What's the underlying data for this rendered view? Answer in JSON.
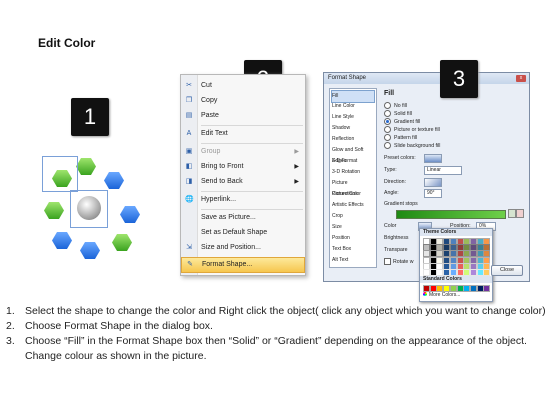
{
  "title": "Edit Color",
  "steps": [
    "1",
    "2",
    "3"
  ],
  "context_menu": {
    "items": [
      {
        "label": "Cut",
        "icon": "scissors-icon"
      },
      {
        "label": "Copy",
        "icon": "copy-icon"
      },
      {
        "label": "Paste",
        "icon": "paste-icon"
      },
      {
        "label": "Edit Text",
        "icon": "edit-text-icon"
      },
      {
        "label": "Group",
        "icon": "group-icon"
      },
      {
        "label": "Bring to Front",
        "icon": "bring-front-icon"
      },
      {
        "label": "Send to Back",
        "icon": "send-back-icon"
      },
      {
        "label": "Hyperlink...",
        "icon": "hyperlink-icon"
      },
      {
        "label": "Save as Picture...",
        "icon": ""
      },
      {
        "label": "Set as Default Shape",
        "icon": ""
      },
      {
        "label": "Size and Position...",
        "icon": "size-icon"
      },
      {
        "label": "Format Shape...",
        "icon": "format-shape-icon"
      }
    ]
  },
  "dialog": {
    "title": "Format Shape",
    "close_label": "x",
    "categories": [
      "Fill",
      "Line Color",
      "Line Style",
      "Shadow",
      "Reflection",
      "Glow and Soft Edges",
      "3-D Format",
      "3-D Rotation",
      "Picture Corrections",
      "Picture Color",
      "Artistic Effects",
      "Crop",
      "Size",
      "Position",
      "Text Box",
      "Alt Text"
    ],
    "section_title": "Fill",
    "fill_options": [
      "No fill",
      "Solid fill",
      "Gradient fill",
      "Picture or texture fill",
      "Pattern fill",
      "Slide background fill"
    ],
    "preset_colors_label": "Preset colors:",
    "type_label": "Type:",
    "type_value": "Linear",
    "direction_label": "Direction:",
    "angle_label": "Angle:",
    "angle_value": "90°",
    "gradient_stops_label": "Gradient stops",
    "color_label": "Color",
    "position_label": "Position:",
    "position_value": "0%",
    "brightness_label": "Brightness",
    "transparency_label": "Transpare",
    "rotate_label": "Rotate w",
    "theme_colors_label": "Theme Colors",
    "standard_colors_label": "Standard Colors",
    "more_colors_label": "More Colors...",
    "close_button": "Close"
  },
  "instructions": [
    "Select the shape to change the color and Right click the object( click any object which you want to change color)",
    "Choose Format Shape in the dialog box.",
    "Choose “Fill” in the Format Shape box then “Solid” or “Gradient” depending on the appearance of the object. Change colour as shown in the picture."
  ],
  "instruction_numbers": [
    "1.",
    "2.",
    "3."
  ],
  "colors": {
    "selection_highlight": "#f6c64f",
    "gradient_bar": "#3aa31f",
    "hex_blue": "#1b64d8",
    "hex_green": "#3aa31f"
  }
}
